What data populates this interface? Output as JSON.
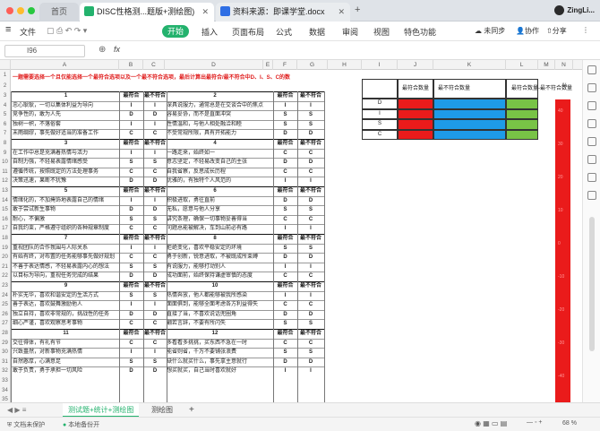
{
  "tabs": [
    {
      "label": "首页"
    },
    {
      "label": "DISC性格测...题版+测绘图)"
    },
    {
      "label": "资料来源：即课学堂.docx"
    }
  ],
  "user": "ZingLi...",
  "menu": {
    "file": "文件",
    "start": "开始",
    "insert": "插入",
    "layout": "页面布局",
    "formula": "公式",
    "data": "数据",
    "review": "审阅",
    "view": "视图",
    "special": "特色功能",
    "sync": "未同步",
    "collab": "协作",
    "share": "分享"
  },
  "formula_bar": {
    "cell_ref": "I96",
    "fx": "fx"
  },
  "columns": [
    "A",
    "B",
    "C",
    "D",
    "E",
    "F",
    "G",
    "H",
    "I",
    "J",
    "K",
    "L",
    "M",
    "N"
  ],
  "sheet": {
    "title": "一题需要选择一个且仅能选择一个最符合选项以及一个最不符合选项，最后计算出最符合/最不符合中D、I、S、C的数",
    "hdr_most": "最符合",
    "hdr_least": "最不符合",
    "groups": [
      {
        "left": "1",
        "right": "2",
        "rows": [
          {
            "a": "忠心耿耿，一切以集体利益为导向",
            "b": "I",
            "c": "I",
            "d": "深具说服力，通常总是在交谈合中的焦点人物",
            "f": "I",
            "g": "I"
          },
          {
            "a": "竞争性的，敢为人先",
            "b": "D",
            "c": "D",
            "d": "容易妥协，而不是直面冲突",
            "f": "S",
            "g": "S"
          },
          {
            "a": "独树一帜，不落俗套",
            "b": "I",
            "c": "I",
            "d": "性情温和，与他人相处融洽和睦",
            "f": "S",
            "g": "S"
          },
          {
            "a": "未雨绸缪，事先做好适当的准备工作",
            "b": "C",
            "c": "C",
            "d": "不受常规所限，具有开拓能力",
            "f": "D",
            "g": "D"
          }
        ]
      },
      {
        "left": "3",
        "right": "4",
        "rows": [
          {
            "a": "在工作中总是充满着热情与活力",
            "b": "I",
            "c": "I",
            "d": "一路走来，始终如一",
            "f": "C",
            "g": "C"
          },
          {
            "a": "自制力强，不轻易表露情绪感受",
            "b": "S",
            "c": "S",
            "d": "意志坚定，不轻易改变自己的主张",
            "f": "D",
            "g": "D"
          },
          {
            "a": "遵循传统，按照既定的方法处理事务",
            "b": "C",
            "c": "C",
            "d": "自我省察，反思成长历程",
            "f": "C",
            "g": "C"
          },
          {
            "a": "决策迅速，果断不犹豫",
            "b": "D",
            "c": "D",
            "d": "优雅的，有独特个人风范的",
            "f": "I",
            "g": "I"
          }
        ]
      },
      {
        "left": "5",
        "right": "6",
        "rows": [
          {
            "a": "情绪化的，不加掩饰地表露自己的情绪",
            "b": "I",
            "c": "I",
            "d": "积极进取，勇往直前",
            "f": "D",
            "g": "D"
          },
          {
            "a": "敢于尝试新生事物",
            "b": "D",
            "c": "D",
            "d": "无私，愿意与他人分享",
            "f": "S",
            "g": "S"
          },
          {
            "a": "耐心，不偏激",
            "b": "S",
            "c": "S",
            "d": "讲究条理，确保一切事物妥善得当",
            "f": "C",
            "g": "C"
          },
          {
            "a": "自我约束，严格遵守组织的各种规章制度",
            "b": "C",
            "c": "C",
            "d": "问题总能被解决，车到山前必有路",
            "f": "I",
            "g": "I"
          }
        ]
      },
      {
        "left": "7",
        "right": "8",
        "rows": [
          {
            "a": "重视团队的合作氛围与人际关系",
            "b": "I",
            "c": "I",
            "d": "拒绝变化，喜欢平稳安定的环境",
            "f": "S",
            "g": "S"
          },
          {
            "a": "有始有终，对布置的任务能够事先做好规划",
            "b": "C",
            "c": "C",
            "d": "勇于创新，锐意进取，不被既成所束缚",
            "f": "D",
            "g": "D"
          },
          {
            "a": "不善于表达情感，不轻易表露内心的想法",
            "b": "S",
            "c": "S",
            "d": "有说服力，能够打动别人",
            "f": "I",
            "g": "I"
          },
          {
            "a": "以目标为导向，重视任务完成的结果",
            "b": "D",
            "c": "D",
            "d": "成功面前，始终保持谦虚审慎的态度",
            "f": "C",
            "g": "C"
          }
        ]
      },
      {
        "left": "9",
        "right": "10",
        "rows": [
          {
            "a": "朴实无华，喜欢和谐安定的生活方式",
            "b": "S",
            "c": "S",
            "d": "热情奔放，他人都能够被我所感染",
            "f": "I",
            "g": "I"
          },
          {
            "a": "善于表达，喜欢鼓舞激励他人",
            "b": "I",
            "c": "I",
            "d": "面面俱到，能够全面考虑各方利益得失",
            "f": "C",
            "g": "C"
          },
          {
            "a": "独立自持，喜欢非常规的，挑战性的任务",
            "b": "D",
            "c": "D",
            "d": "直接了当，不喜欢说话兜圈角",
            "f": "D",
            "g": "D"
          },
          {
            "a": "细心严谨，喜欢观察思考事物",
            "b": "C",
            "c": "C",
            "d": "翩若言辞，不要有所闪失",
            "f": "S",
            "g": "S"
          }
        ]
      },
      {
        "left": "11",
        "right": "12",
        "rows": [
          {
            "a": "交往得体，有礼有节",
            "b": "C",
            "c": "C",
            "d": "多看看多挑挑，买东西不急在一时",
            "f": "C",
            "g": "C"
          },
          {
            "a": "兴致盎然，对新事物充满热情",
            "b": "I",
            "c": "I",
            "d": "能省则省，千万不要铺张浪费",
            "f": "S",
            "g": "S"
          },
          {
            "a": "自然憨厚，心满意足",
            "b": "S",
            "c": "S",
            "d": "缺什么就买什么，事先拿主意就行",
            "f": "D",
            "g": "D"
          },
          {
            "a": "敢于负责，勇于承担一切风险",
            "b": "D",
            "c": "D",
            "d": "想买就买，自己当时喜欢就好",
            "f": "I",
            "g": "I"
          }
        ]
      }
    ]
  },
  "summary": {
    "h_most": "最符合数量",
    "h_least": "最不符合数量",
    "h_diff": "最符合数量-最不符合数量",
    "labels": [
      "D",
      "I",
      "S",
      "C"
    ]
  },
  "red_col": {
    "header": "%",
    "labels": [
      "40",
      "30",
      "20",
      "10",
      "0",
      "-10",
      "-20",
      "-30",
      "-40"
    ]
  },
  "sheet_tabs": [
    {
      "label": "测试题+统计+测绘图"
    },
    {
      "label": "测绘图"
    }
  ],
  "status": {
    "protect": "文档未保护",
    "backup": "本地备份开",
    "zoom": "68 %"
  },
  "colors": {
    "accent": "#23b26d",
    "red": "#ea1b1b",
    "blue": "#1e9be8",
    "green": "#78c346"
  }
}
